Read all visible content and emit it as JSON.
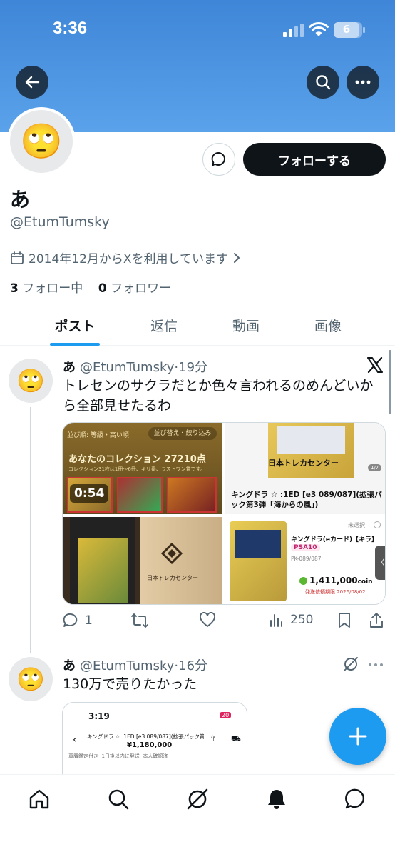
{
  "status_bar": {
    "time": "3:36",
    "battery": "6"
  },
  "profile": {
    "avatar_emoji": "🙄",
    "name": "あ",
    "handle": "@EtumTumsky",
    "joined": "2014年12月からXを利用しています",
    "following_count": "3",
    "following_label": "フォロー中",
    "followers_count": "0",
    "followers_label": "フォロワー",
    "follow_label": "フォローする"
  },
  "tabs": [
    {
      "label": "ポスト",
      "active": true
    },
    {
      "label": "返信"
    },
    {
      "label": "動画"
    },
    {
      "label": "画像"
    }
  ],
  "posts": [
    {
      "name": "あ",
      "handle": "@EtumTumsky",
      "time": "19分",
      "text": "トレセンのサクラだとか色々言われるのめんどいから全部見せたるわ",
      "media": {
        "c1_top": "並び順: 等級・高い順",
        "c1_sort": "並び替え・絞り込み",
        "c1_title": "あなたのコレクション 27210点",
        "c1_sub": "コレクション31枚は1冊～6冊、キリ番、ラストワン賞です。",
        "video_time": "0:54",
        "c2_caption": "キングドラ ☆ :1ED [e3 089/087](拡張パック第3弾「海からの風」)",
        "c2_page": "1/7",
        "c2_logo": "日本トレカセンター",
        "c3_box_text": "日本トレカセンター",
        "c4_unselected": "未選択",
        "c4_title": "キングドラ(eカード)【キラ】",
        "c4_grade": "PSA10",
        "c4_code": "PK-089/087",
        "c4_price": "1,411,000",
        "c4_unit": "coin",
        "c4_deadline": "発送依頼期限 2026/08/02"
      },
      "replies": "1",
      "views": "250"
    },
    {
      "name": "あ",
      "handle": "@EtumTumsky",
      "time": "16分",
      "text": "130万で売りたかった",
      "embed": {
        "time": "3:19",
        "battery": "20",
        "title": "キングドラ ☆ :1ED [e3 089/087](拡張パック第3弾…",
        "price": "¥1,180,000",
        "tag1": "真贋鑑定付き",
        "tag2": "1日後以内に発送",
        "tag3": "本人確認済"
      }
    }
  ],
  "colors": {
    "accent": "#1d9bf0",
    "banner": "#4a92e0",
    "text": "#0f1419",
    "muted": "#536471"
  }
}
